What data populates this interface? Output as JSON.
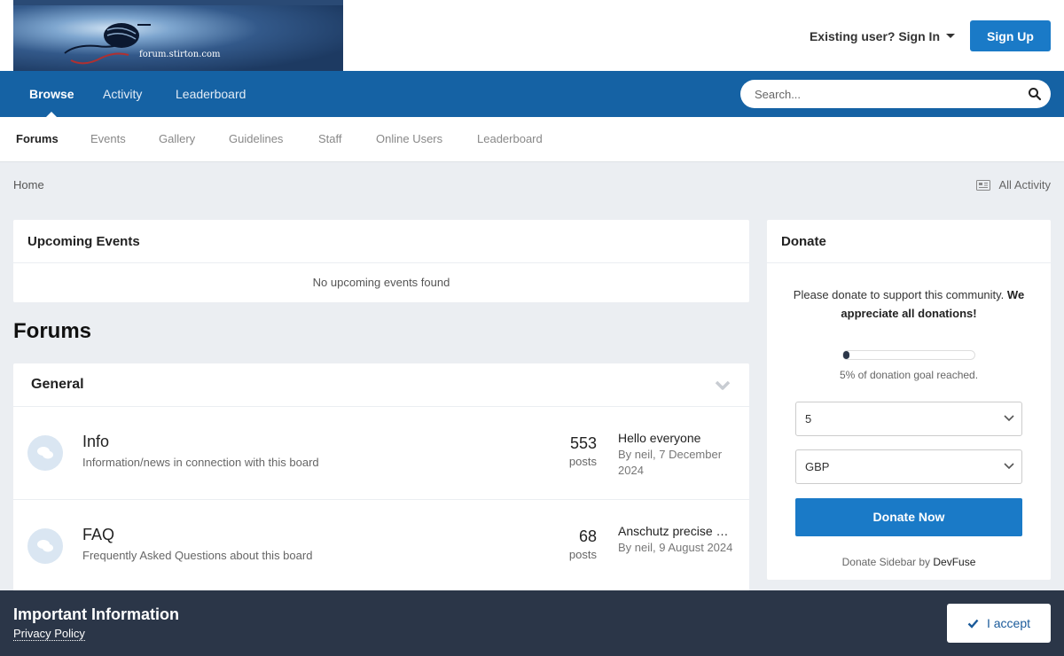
{
  "header": {
    "logo_text": "forum.stirton.com",
    "signin_label": "Existing user? Sign In",
    "signup_label": "Sign Up"
  },
  "primary_nav": {
    "tabs": [
      {
        "label": "Browse",
        "active": true
      },
      {
        "label": "Activity",
        "active": false
      },
      {
        "label": "Leaderboard",
        "active": false
      }
    ],
    "search_placeholder": "Search..."
  },
  "secondary_nav": {
    "items": [
      {
        "label": "Forums",
        "active": true
      },
      {
        "label": "Events"
      },
      {
        "label": "Gallery"
      },
      {
        "label": "Guidelines"
      },
      {
        "label": "Staff"
      },
      {
        "label": "Online Users"
      },
      {
        "label": "Leaderboard"
      }
    ]
  },
  "breadcrumb": {
    "home": "Home",
    "all_activity": "All Activity"
  },
  "events": {
    "title": "Upcoming Events",
    "empty_text": "No upcoming events found"
  },
  "forums": {
    "heading": "Forums",
    "category": "General",
    "rows": [
      {
        "name": "Info",
        "description": "Information/news in connection with this board",
        "count": "553",
        "count_label": "posts",
        "last_title": "Hello everyone",
        "last_meta": "By neil, 7 December 2024"
      },
      {
        "name": "FAQ",
        "description": "Frequently Asked Questions about this board",
        "count": "68",
        "count_label": "posts",
        "last_title": "Anschutz precise …",
        "last_meta": "By neil, 9 August 2024"
      }
    ]
  },
  "donate": {
    "title": "Donate",
    "text_plain": "Please donate to support this community.",
    "text_bold": "We appreciate all donations!",
    "progress_percent": 5,
    "progress_label": "5% of donation goal reached.",
    "amount": "5",
    "currency": "GBP",
    "button_label": "Donate Now",
    "credit_prefix": "Donate Sidebar by",
    "credit_link": "DevFuse"
  },
  "cookie": {
    "title": "Important Information",
    "link": "Privacy Policy",
    "accept_label": "I accept"
  },
  "colors": {
    "nav_blue": "#1562a4",
    "button_blue": "#1a7ac7",
    "footer_dark": "#2b3648",
    "page_bg": "#ebeef2"
  }
}
